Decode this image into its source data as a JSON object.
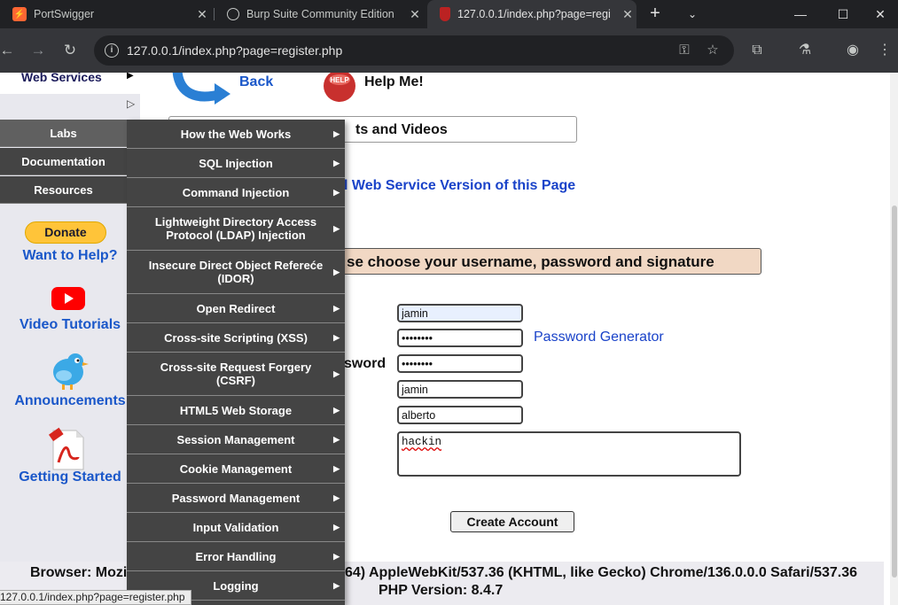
{
  "tabs": [
    {
      "title": "PortSwigger",
      "icon": "portswigger-icon"
    },
    {
      "title": "Burp Suite Community Edition",
      "icon": "globe-icon"
    },
    {
      "title": "127.0.0.1/index.php?page=regi",
      "icon": "mutillidae-icon"
    }
  ],
  "address_bar": {
    "url": "127.0.0.1/index.php?page=register.php"
  },
  "left_menu": {
    "web_services": "Web Services",
    "items": [
      "Labs",
      "Documentation",
      "Resources"
    ]
  },
  "flyout_menu": [
    "How the Web Works",
    "SQL Injection",
    "Command Injection",
    "Lightweight Directory Access Protocol (LDAP) Injection",
    "Insecure Direct Object Refereće (IDOR)",
    "Open Redirect",
    "Cross-site Scripting (XSS)",
    "Cross-site Request Forgery (CSRF)",
    "HTML5 Web Storage",
    "Session Management",
    "Cookie Management",
    "Password Management",
    "Input Validation",
    "Error Handling",
    "Logging"
  ],
  "sidebar": {
    "donate": "Donate",
    "want_help": "Want to Help?",
    "video_tutorials": "Video Tutorials",
    "announcements": "Announcements",
    "getting_started": "Getting Started"
  },
  "page": {
    "back": "Back",
    "help": "Help Me!",
    "hints_visible": "ts and Videos",
    "ws_version_visible": "l Web Service Version of this Page",
    "banner_visible": "se choose your username, password and signature",
    "confirm_label_visible": "sword",
    "password_generator": "Password Generator",
    "create_account": "Create Account"
  },
  "form": {
    "username": "jamin",
    "password": "••••••••",
    "confirm_password": "••••••••",
    "first_name": "jamin",
    "last_name": "alberto",
    "signature": "hackin"
  },
  "footer": {
    "browser_prefix": "Browser: Mozil",
    "browser_suffix": "64) AppleWebKit/537.36 (KHTML, like Gecko) Chrome/136.0.0.0 Safari/537.36",
    "php_version": "PHP Version: 8.4.7"
  },
  "status_bar_url": "127.0.0.1/index.php?page=register.php"
}
